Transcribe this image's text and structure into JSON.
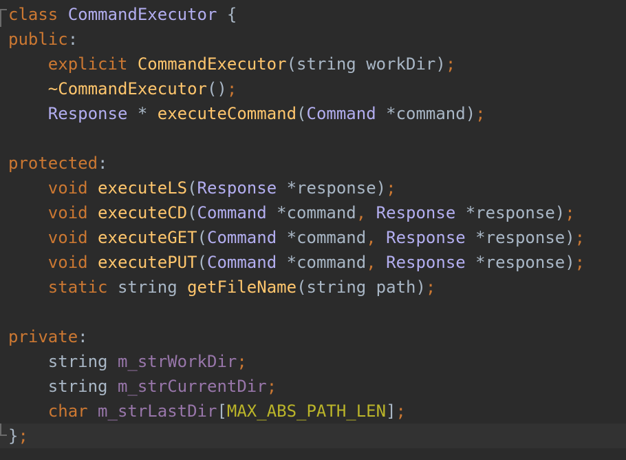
{
  "colors": {
    "background": "#2b2b2b",
    "current_line": "#323232",
    "keyword": "#cc7832",
    "class_name": "#b3aef0",
    "function": "#ffc66d",
    "plain": "#a9b7c6",
    "member": "#9876aa",
    "macro": "#bbb529"
  },
  "code": {
    "l1": {
      "kw": "class",
      "name": "CommandExecutor",
      "brace": "{"
    },
    "l2": {
      "kw": "public",
      "colon": ":"
    },
    "l3": {
      "kw": "explicit",
      "fn": "CommandExecutor",
      "open": "(",
      "type": "string",
      "param": "workDir",
      "close": ")",
      "semi": ";"
    },
    "l4": {
      "fn": "~CommandExecutor",
      "parens": "()",
      "semi": ";"
    },
    "l5": {
      "type": "Response",
      "star": "*",
      "fn": "executeCommand",
      "open": "(",
      "ptype": "Command",
      "pstar": "*",
      "param": "command",
      "close": ")",
      "semi": ";"
    },
    "l7": {
      "kw": "protected",
      "colon": ":"
    },
    "l8": {
      "kw": "void",
      "fn": "executeLS",
      "open": "(",
      "ptype": "Response",
      "pstar": "*",
      "param": "response",
      "close": ")",
      "semi": ";"
    },
    "l9": {
      "kw": "void",
      "fn": "executeCD",
      "open": "(",
      "ptype1": "Command",
      "pstar1": "*",
      "param1": "command",
      "comma": ",",
      "ptype2": "Response",
      "pstar2": "*",
      "param2": "response",
      "close": ")",
      "semi": ";"
    },
    "l10": {
      "kw": "void",
      "fn": "executeGET",
      "open": "(",
      "ptype1": "Command",
      "pstar1": "*",
      "param1": "command",
      "comma": ",",
      "ptype2": "Response",
      "pstar2": "*",
      "param2": "response",
      "close": ")",
      "semi": ";"
    },
    "l11": {
      "kw": "void",
      "fn": "executePUT",
      "open": "(",
      "ptype1": "Command",
      "pstar1": "*",
      "param1": "command",
      "comma": ",",
      "ptype2": "Response",
      "pstar2": "*",
      "param2": "response",
      "close": ")",
      "semi": ";"
    },
    "l12": {
      "kw": "static",
      "type": "string",
      "fn": "getFileName",
      "open": "(",
      "ptype": "string",
      "param": "path",
      "close": ")",
      "semi": ";"
    },
    "l14": {
      "kw": "private",
      "colon": ":"
    },
    "l15": {
      "type": "string",
      "member": "m_strWorkDir",
      "semi": ";"
    },
    "l16": {
      "type": "string",
      "member": "m_strCurrentDir",
      "semi": ";"
    },
    "l17": {
      "kw": "char",
      "member": "m_strLastDir",
      "open": "[",
      "macro": "MAX_ABS_PATH_LEN",
      "close": "]",
      "semi": ";"
    },
    "l18": {
      "brace": "}",
      "semi": ";"
    }
  }
}
